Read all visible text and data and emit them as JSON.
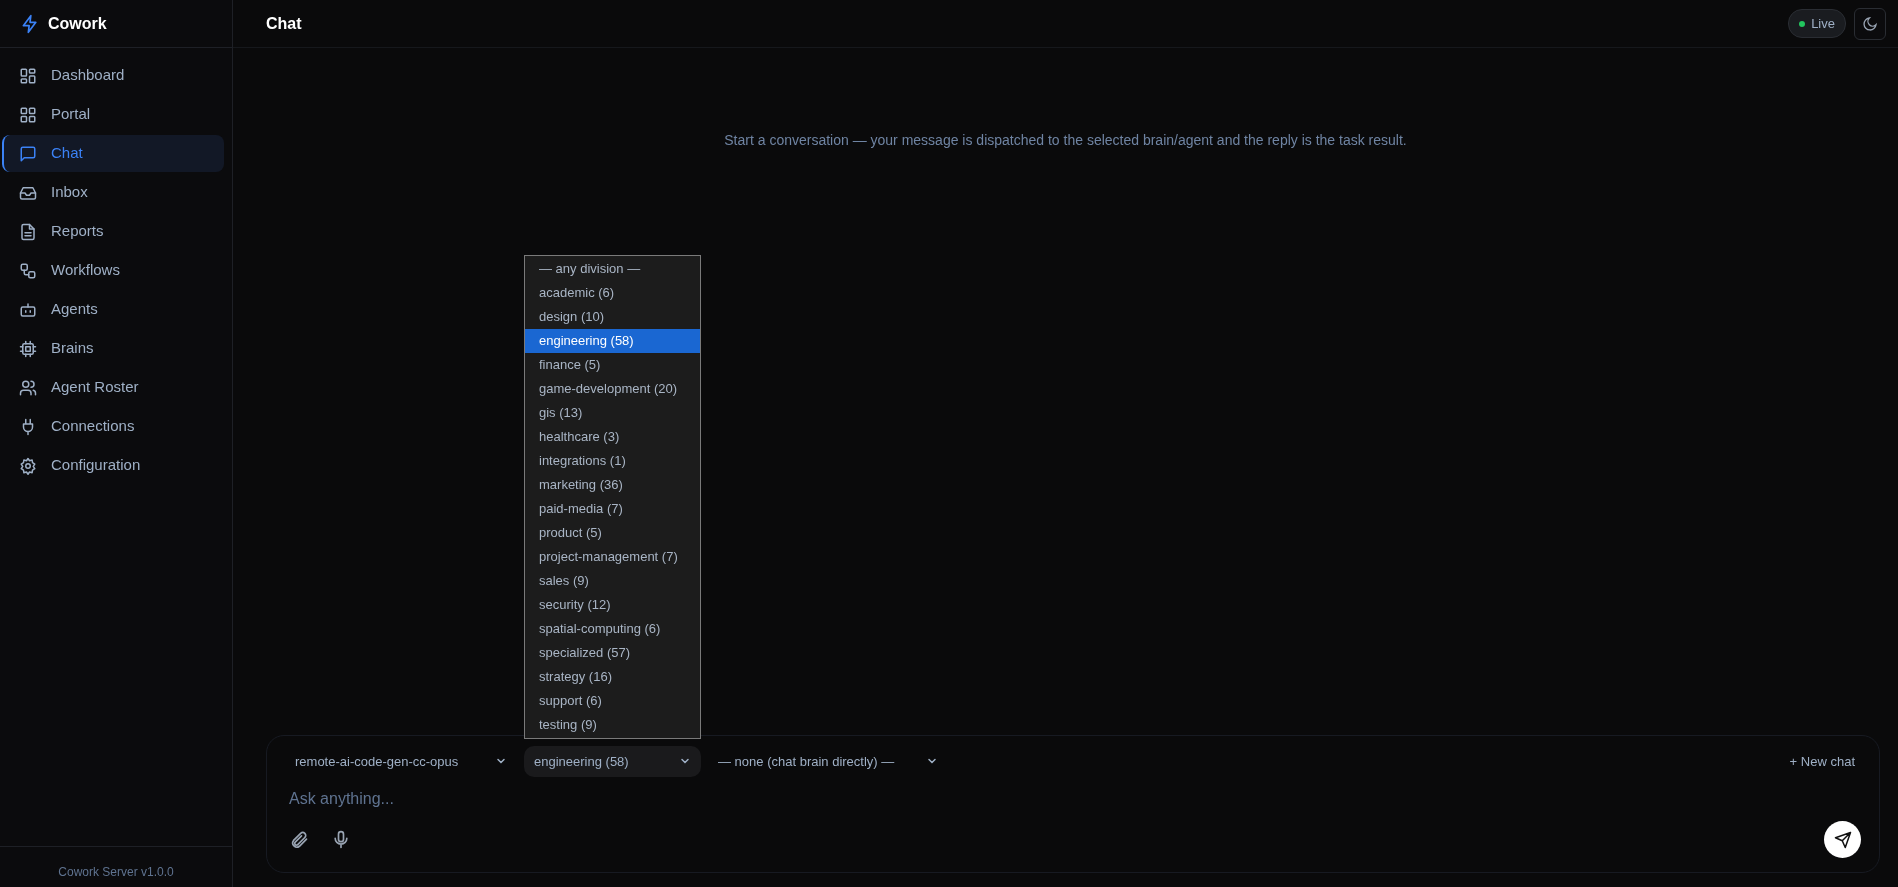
{
  "sidebar": {
    "brand": "Cowork",
    "items": [
      {
        "label": "Dashboard",
        "selected": false
      },
      {
        "label": "Portal",
        "selected": false
      },
      {
        "label": "Chat",
        "selected": true
      },
      {
        "label": "Inbox",
        "selected": false
      },
      {
        "label": "Reports",
        "selected": false
      },
      {
        "label": "Workflows",
        "selected": false
      },
      {
        "label": "Agents",
        "selected": false
      },
      {
        "label": "Brains",
        "selected": false
      },
      {
        "label": "Agent Roster",
        "selected": false
      },
      {
        "label": "Connections",
        "selected": false
      },
      {
        "label": "Configuration",
        "selected": false
      }
    ],
    "footer": "Cowork Server v1.0.0"
  },
  "header": {
    "title": "Chat",
    "status": "Live"
  },
  "empty_message": "Start a conversation — your message is dispatched to the selected brain/agent and the reply is the task result.",
  "composer": {
    "brain_select": "remote-ai-code-gen-cc-opus",
    "division_select": {
      "value": "engineering (58)",
      "expanded": true,
      "options": [
        {
          "label": "— any division —",
          "selected": false
        },
        {
          "label": "academic (6)",
          "selected": false
        },
        {
          "label": "design (10)",
          "selected": false
        },
        {
          "label": "engineering (58)",
          "selected": true
        },
        {
          "label": "finance (5)",
          "selected": false
        },
        {
          "label": "game-development (20)",
          "selected": false
        },
        {
          "label": "gis (13)",
          "selected": false
        },
        {
          "label": "healthcare (3)",
          "selected": false
        },
        {
          "label": "integrations (1)",
          "selected": false
        },
        {
          "label": "marketing (36)",
          "selected": false
        },
        {
          "label": "paid-media (7)",
          "selected": false
        },
        {
          "label": "product (5)",
          "selected": false
        },
        {
          "label": "project-management (7)",
          "selected": false
        },
        {
          "label": "sales (9)",
          "selected": false
        },
        {
          "label": "security (12)",
          "selected": false
        },
        {
          "label": "spatial-computing (6)",
          "selected": false
        },
        {
          "label": "specialized (57)",
          "selected": false
        },
        {
          "label": "strategy (16)",
          "selected": false
        },
        {
          "label": "support (6)",
          "selected": false
        },
        {
          "label": "testing (9)",
          "selected": false
        }
      ]
    },
    "agent_select": "— none (chat brain directly) —",
    "new_chat": "+ New chat",
    "placeholder": "Ask anything..."
  }
}
